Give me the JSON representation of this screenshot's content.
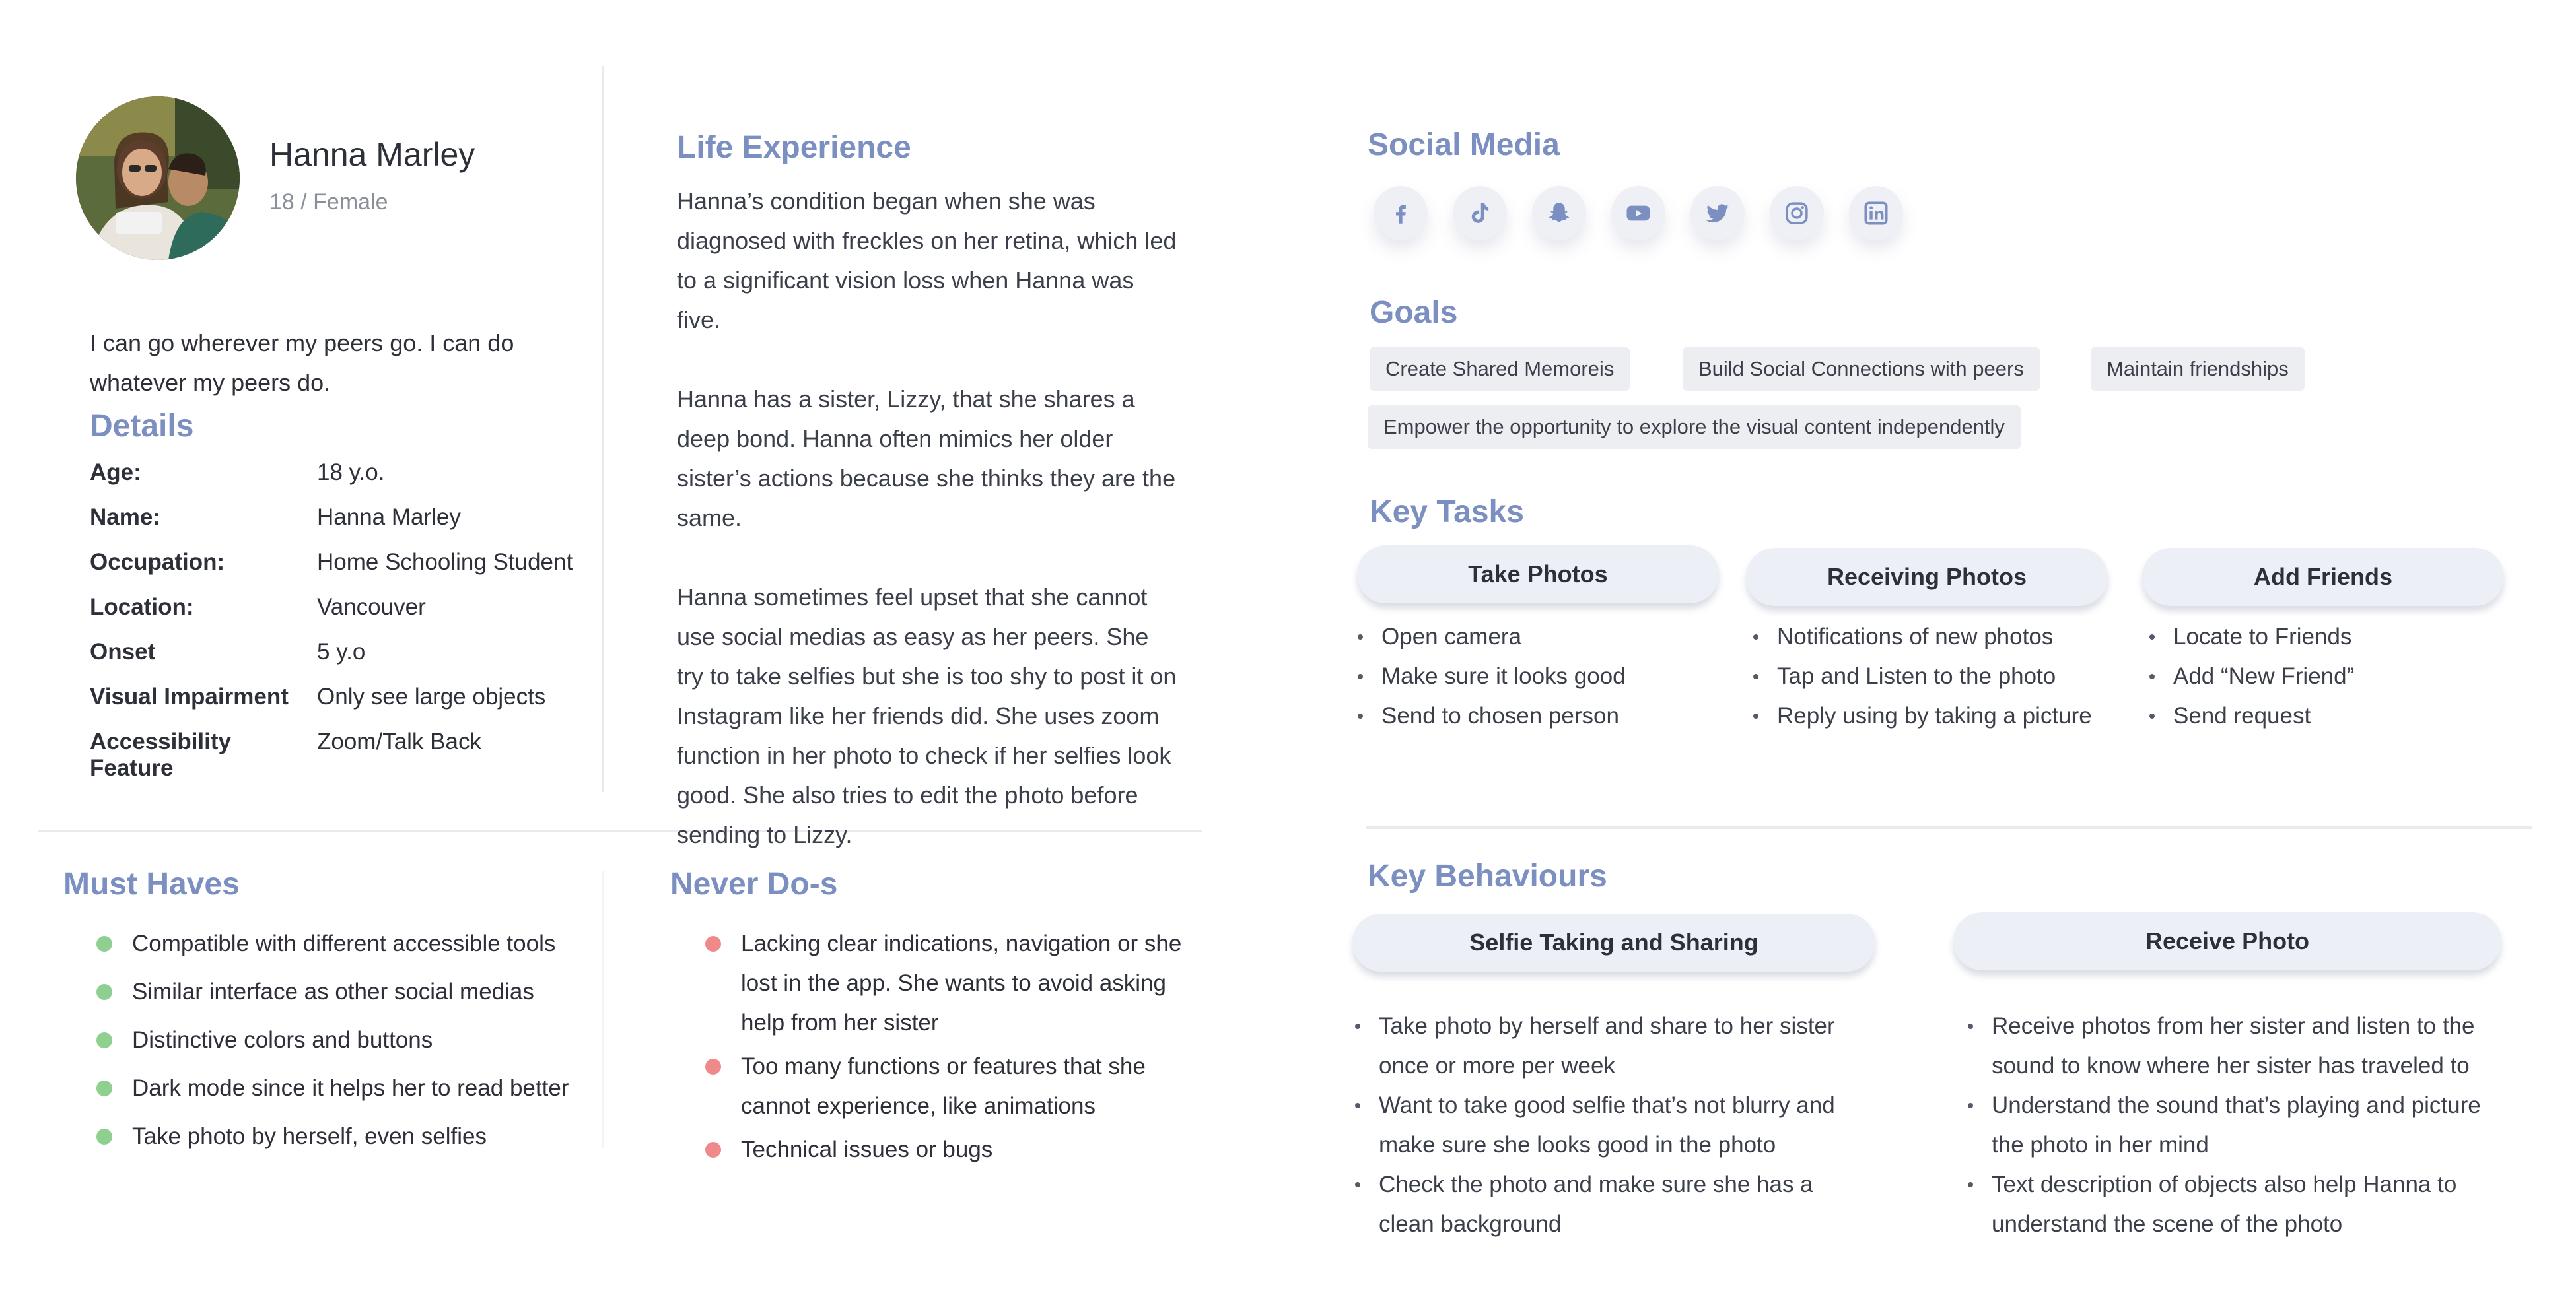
{
  "profile": {
    "name": "Hanna Marley",
    "age_gender": "18 / Female",
    "quote": "I can go wherever my peers go. I can do whatever my peers do."
  },
  "details": {
    "heading": "Details",
    "rows": [
      {
        "key": "Age:",
        "value": "18 y.o."
      },
      {
        "key": "Name:",
        "value": "Hanna Marley"
      },
      {
        "key": "Occupation:",
        "value": "Home Schooling Student"
      },
      {
        "key": "Location:",
        "value": "Vancouver"
      },
      {
        "key": "Onset",
        "value": "5 y.o"
      },
      {
        "key": "Visual Impairment",
        "value": "Only see large objects"
      },
      {
        "key": "Accessibility Feature",
        "value": "Zoom/Talk Back"
      }
    ]
  },
  "life_experience": {
    "heading": "Life Experience",
    "paragraphs": [
      "Hanna’s condition began when she was diagnosed with freckles on her retina, which led to a significant vision loss when Hanna was five.",
      "Hanna has a sister, Lizzy, that she shares a deep bond. Hanna often mimics her older sister’s actions because she thinks they are the same.",
      "Hanna sometimes feel upset that she cannot use social medias as easy as her peers. She try to take selfies but she is too shy to post it on Instagram like her friends did. She uses zoom function in her photo to check if her selfies look good. She also tries to edit the photo before sending to Lizzy."
    ]
  },
  "must_haves": {
    "heading": "Must Haves",
    "items": [
      "Compatible with different accessible tools",
      "Similar interface as other social medias",
      "Distinctive colors and buttons",
      "Dark mode since it helps her to read better",
      "Take photo by herself, even selfies"
    ]
  },
  "never_dos": {
    "heading": "Never Do-s",
    "items": [
      "Lacking clear indications, navigation or she lost in the app. She wants to avoid asking help from her sister",
      "Too many functions or features that she cannot experience, like animations",
      "Technical issues or bugs"
    ]
  },
  "social_media": {
    "heading": "Social Media",
    "icons": [
      "facebook-icon",
      "tiktok-icon",
      "snapchat-icon",
      "youtube-icon",
      "twitter-icon",
      "instagram-icon",
      "linkedin-icon"
    ]
  },
  "goals": {
    "heading": "Goals",
    "tags": [
      "Create Shared Memoreis",
      "Build Social Connections with peers",
      "Maintain friendships",
      "Empower the  opportunity to explore the visual content independently"
    ]
  },
  "key_tasks": {
    "heading": "Key Tasks",
    "columns": [
      {
        "title": "Take Photos",
        "items": [
          "Open camera",
          "Make sure it looks good",
          "Send to chosen person"
        ]
      },
      {
        "title": "Receiving Photos",
        "items": [
          "Notifications of new photos",
          "Tap and Listen to the photo",
          "Reply using by taking a picture"
        ]
      },
      {
        "title": "Add Friends",
        "items": [
          "Locate to Friends",
          "Add “New Friend”",
          "Send request"
        ]
      }
    ]
  },
  "key_behaviours": {
    "heading": "Key Behaviours",
    "columns": [
      {
        "title": "Selfie Taking and Sharing",
        "items": [
          "Take photo by herself and share to her sister once or more per week",
          "Want to take good selfie that’s not blurry and make sure she looks good in the photo",
          "Check the photo and make sure she has a clean background"
        ]
      },
      {
        "title": "Receive Photo",
        "items": [
          "Receive photos from her sister and listen to the sound to know where her sister has traveled to",
          "Understand the sound that’s playing and picture the photo in her mind",
          "Text description of objects also help Hanna to understand the scene of the photo"
        ]
      }
    ]
  },
  "colors": {
    "heading": "#7b8fc0",
    "must_have_dot": "#8fcf8f",
    "never_do_dot": "#f08a8a",
    "social_icon": "#7b8fc0"
  }
}
